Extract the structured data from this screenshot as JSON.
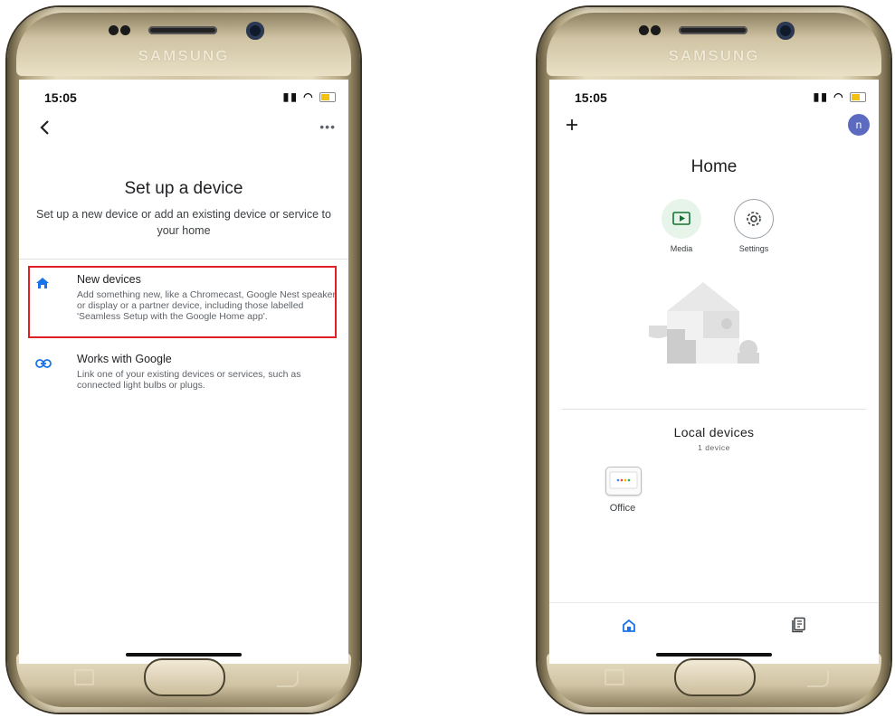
{
  "left_phone": {
    "brand": "SAMSUNG",
    "status_time": "15:05",
    "title": "Set up a device",
    "subtitle": "Set up a new device or add an existing device or service to your home",
    "options": [
      {
        "label": "New devices",
        "description": "Add something new, like a Chromecast, Google Nest speaker or display or a partner device, including those labelled 'Seamless Setup with the Google Home app'.",
        "icon": "home-icon",
        "highlighted": true
      },
      {
        "label": "Works with Google",
        "description": "Link one of your existing devices or services, such as connected light bulbs or plugs.",
        "icon": "link-icon",
        "highlighted": false
      }
    ],
    "more_label": "•••"
  },
  "right_phone": {
    "brand": "SAMSUNG",
    "status_time": "15:05",
    "avatar_initial": "n",
    "home_title": "Home",
    "chips": [
      {
        "label": "Media",
        "icon": "media-icon"
      },
      {
        "label": "Settings",
        "icon": "gear-icon"
      }
    ],
    "local_devices_title": "Local devices",
    "local_devices_count": "1 device",
    "device_label": "Office",
    "nav_icons": [
      "home-icon",
      "feed-icon"
    ]
  },
  "colors": {
    "accent_blue": "#1a73e8",
    "highlight_red": "#e01f26",
    "avatar": "#5c6bc0",
    "media_chip": "#e6f4ea"
  }
}
